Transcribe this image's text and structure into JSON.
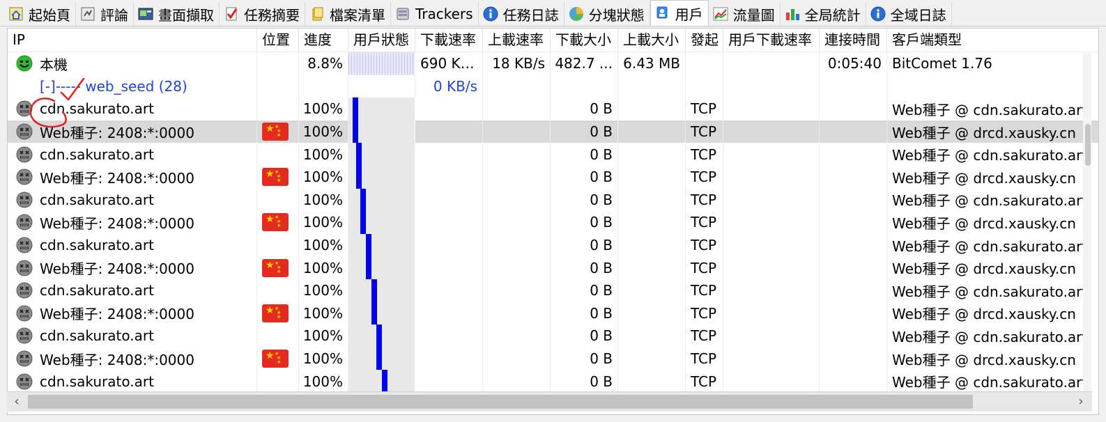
{
  "tabs": [
    {
      "label": "起始頁",
      "icon": "home-icon"
    },
    {
      "label": "評論",
      "icon": "comment-icon"
    },
    {
      "label": "畫面擷取",
      "icon": "screenshot-icon"
    },
    {
      "label": "任務摘要",
      "icon": "checklist-icon"
    },
    {
      "label": "檔案清單",
      "icon": "files-icon"
    },
    {
      "label": "Trackers",
      "icon": "server-icon"
    },
    {
      "label": "任務日誌",
      "icon": "info-icon"
    },
    {
      "label": "分塊狀態",
      "icon": "pie-icon"
    },
    {
      "label": "用戶",
      "icon": "user-icon",
      "active": true
    },
    {
      "label": "流量圖",
      "icon": "graph-icon"
    },
    {
      "label": "全局統計",
      "icon": "stats-icon"
    },
    {
      "label": "全域日誌",
      "icon": "info-icon"
    }
  ],
  "columns": [
    "IP",
    "位置",
    "進度",
    "用戶狀態",
    "下載速率",
    "上載速率",
    "下載大小",
    "上載大小",
    "發起",
    "用戶下載速率",
    "連接時間",
    "客戶端類型"
  ],
  "local": {
    "ip": "本機",
    "progress": "8.8%",
    "download_rate": "690 KB...",
    "upload_rate": "18 KB/s",
    "download_size": "482.7 ...",
    "upload_size": "6.43 MB",
    "connect_time": "0:05:40",
    "client": "BitComet 1.76"
  },
  "group": {
    "label": "[-]----- web_seed (28)",
    "download_rate": "0 KB/s"
  },
  "peers": [
    {
      "ip": "cdn.sakurato.art",
      "flag": false,
      "progress": "100%",
      "bar": 0.06,
      "download_size": "0 B",
      "origin": "TCP",
      "client": "Web種子 @ cdn.sakurato.art"
    },
    {
      "ip": "Web種子: 2408:*:0000",
      "flag": true,
      "progress": "100%",
      "bar": 0.06,
      "download_size": "0 B",
      "origin": "TCP",
      "client": "Web種子 @ drcd.xausky.cn",
      "selected": true
    },
    {
      "ip": "cdn.sakurato.art",
      "flag": false,
      "progress": "100%",
      "bar": 0.11,
      "download_size": "0 B",
      "origin": "TCP",
      "client": "Web種子 @ cdn.sakurato.art"
    },
    {
      "ip": "Web種子: 2408:*:0000",
      "flag": true,
      "progress": "100%",
      "bar": 0.11,
      "download_size": "0 B",
      "origin": "TCP",
      "client": "Web種子 @ drcd.xausky.cn"
    },
    {
      "ip": "cdn.sakurato.art",
      "flag": false,
      "progress": "100%",
      "bar": 0.18,
      "download_size": "0 B",
      "origin": "TCP",
      "client": "Web種子 @ cdn.sakurato.art"
    },
    {
      "ip": "Web種子: 2408:*:0000",
      "flag": true,
      "progress": "100%",
      "bar": 0.18,
      "download_size": "0 B",
      "origin": "TCP",
      "client": "Web種子 @ drcd.xausky.cn"
    },
    {
      "ip": "cdn.sakurato.art",
      "flag": false,
      "progress": "100%",
      "bar": 0.26,
      "download_size": "0 B",
      "origin": "TCP",
      "client": "Web種子 @ cdn.sakurato.art"
    },
    {
      "ip": "Web種子: 2408:*:0000",
      "flag": true,
      "progress": "100%",
      "bar": 0.26,
      "download_size": "0 B",
      "origin": "TCP",
      "client": "Web種子 @ drcd.xausky.cn"
    },
    {
      "ip": "cdn.sakurato.art",
      "flag": false,
      "progress": "100%",
      "bar": 0.34,
      "download_size": "0 B",
      "origin": "TCP",
      "client": "Web種子 @ cdn.sakurato.art"
    },
    {
      "ip": "Web種子: 2408:*:0000",
      "flag": true,
      "progress": "100%",
      "bar": 0.34,
      "download_size": "0 B",
      "origin": "TCP",
      "client": "Web種子 @ drcd.xausky.cn"
    },
    {
      "ip": "cdn.sakurato.art",
      "flag": false,
      "progress": "100%",
      "bar": 0.42,
      "download_size": "0 B",
      "origin": "TCP",
      "client": "Web種子 @ cdn.sakurato.art"
    },
    {
      "ip": "Web種子: 2408:*:0000",
      "flag": true,
      "progress": "100%",
      "bar": 0.42,
      "download_size": "0 B",
      "origin": "TCP",
      "client": "Web種子 @ drcd.xausky.cn"
    },
    {
      "ip": "cdn.sakurato.art",
      "flag": false,
      "progress": "100%",
      "bar": 0.5,
      "download_size": "0 B",
      "origin": "TCP",
      "client": "Web種子 @ cdn.sakurato.art"
    }
  ],
  "colors": {
    "accent_blue": "#1f45d8",
    "bar_blue": "#0000ee",
    "flag_red": "#e32b20",
    "selected_row": "#d9d9d9",
    "annotation_red": "#e02020"
  }
}
